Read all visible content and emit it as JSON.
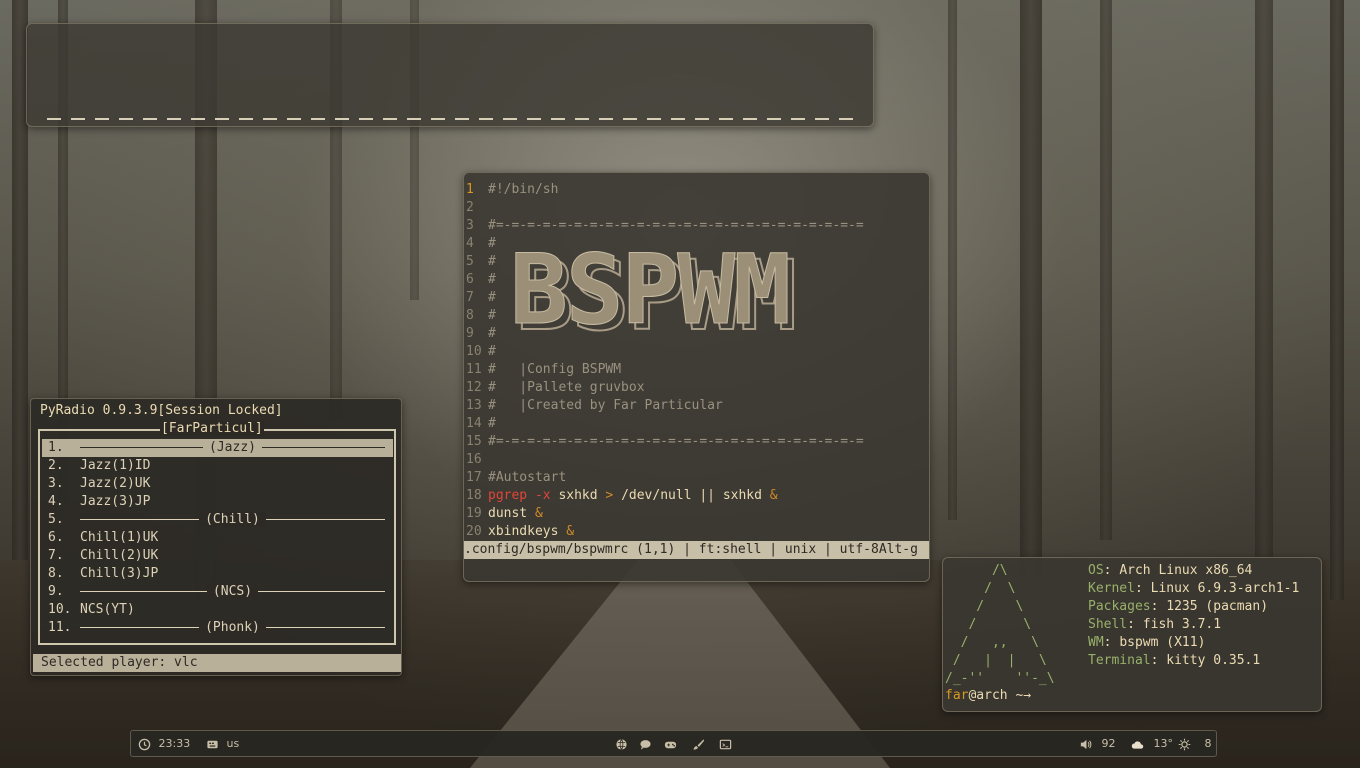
{
  "top_widget": {},
  "editor": {
    "lines": [
      {
        "n": "1",
        "segs": [
          {
            "t": "#!/bin/sh",
            "c": "cmt"
          }
        ],
        "current": true
      },
      {
        "n": "2",
        "segs": []
      },
      {
        "n": "3",
        "segs": [
          {
            "t": "#=-=-=-=-=-=-=-=-=-=-=-=-=-=-=-=-=-=-=-=-=-=-=-=",
            "c": "cmt"
          }
        ]
      },
      {
        "n": "4",
        "segs": [
          {
            "t": "#",
            "c": "cmt"
          }
        ]
      },
      {
        "n": "5",
        "segs": [
          {
            "t": "#",
            "c": "cmt"
          }
        ]
      },
      {
        "n": "6",
        "segs": [
          {
            "t": "#",
            "c": "cmt"
          }
        ]
      },
      {
        "n": "7",
        "segs": [
          {
            "t": "#",
            "c": "cmt"
          }
        ]
      },
      {
        "n": "8",
        "segs": [
          {
            "t": "#",
            "c": "cmt"
          }
        ]
      },
      {
        "n": "9",
        "segs": [
          {
            "t": "#",
            "c": "cmt"
          }
        ]
      },
      {
        "n": "10",
        "segs": [
          {
            "t": "#",
            "c": "cmt"
          }
        ]
      },
      {
        "n": "11",
        "segs": [
          {
            "t": "#   |Config BSPWM",
            "c": "cmt"
          }
        ]
      },
      {
        "n": "12",
        "segs": [
          {
            "t": "#   |Pallete gruvbox",
            "c": "cmt"
          }
        ]
      },
      {
        "n": "13",
        "segs": [
          {
            "t": "#   |Created by Far Particular",
            "c": "cmt"
          }
        ]
      },
      {
        "n": "14",
        "segs": [
          {
            "t": "#",
            "c": "cmt"
          }
        ]
      },
      {
        "n": "15",
        "segs": [
          {
            "t": "#=-=-=-=-=-=-=-=-=-=-=-=-=-=-=-=-=-=-=-=-=-=-=-=",
            "c": "cmt"
          }
        ]
      },
      {
        "n": "16",
        "segs": []
      },
      {
        "n": "17",
        "segs": [
          {
            "t": "#Autostart",
            "c": "cmt"
          }
        ]
      },
      {
        "n": "18",
        "segs": [
          {
            "t": "pgrep",
            "c": "kw"
          },
          {
            "t": " ",
            "c": "txt"
          },
          {
            "t": "-x",
            "c": "kw"
          },
          {
            "t": " sxhkd ",
            "c": "txt"
          },
          {
            "t": ">",
            "c": "op"
          },
          {
            "t": " /dev/null || sxhkd ",
            "c": "txt"
          },
          {
            "t": "&",
            "c": "op"
          }
        ]
      },
      {
        "n": "19",
        "segs": [
          {
            "t": "dunst ",
            "c": "txt"
          },
          {
            "t": "&",
            "c": "op"
          }
        ]
      },
      {
        "n": "20",
        "segs": [
          {
            "t": "xbindkeys ",
            "c": "txt"
          },
          {
            "t": "&",
            "c": "op"
          }
        ]
      }
    ],
    "banner_text": "BSPWM",
    "status_line": ".config/bspwm/bspwmrc (1,1) | ft:shell | unix | utf-8Alt-g"
  },
  "radio": {
    "title": "PyRadio 0.9.3.9[Session Locked]",
    "box_title": "[FarParticul]",
    "rows": [
      {
        "num": "1.",
        "name": "(Jazz)",
        "group": true,
        "selected": true
      },
      {
        "num": "2.",
        "name": "Jazz(1)ID"
      },
      {
        "num": "3.",
        "name": "Jazz(2)UK"
      },
      {
        "num": "4.",
        "name": "Jazz(3)JP"
      },
      {
        "num": "5.",
        "name": "(Chill)",
        "group": true
      },
      {
        "num": "6.",
        "name": "Chill(1)UK"
      },
      {
        "num": "7.",
        "name": "Chill(2)UK"
      },
      {
        "num": "8.",
        "name": "Chill(3)JP"
      },
      {
        "num": "9.",
        "name": "(NCS)",
        "group": true
      },
      {
        "num": "10.",
        "name": "NCS(YT)"
      },
      {
        "num": "11.",
        "name": "(Phonk)",
        "group": true
      }
    ],
    "status": "Selected player: vlc"
  },
  "fetch": {
    "art": "      /\\\n     /  \\\n    /    \\\n   /      \\\n  /   ,,   \\\n /   |  |   \\\n/_-''    ''-_\\",
    "info": [
      {
        "key": "OS",
        "val": "Arch Linux x86_64"
      },
      {
        "key": "Kernel",
        "val": "Linux 6.9.3-arch1-1"
      },
      {
        "key": "Packages",
        "val": "1235 (pacman)"
      },
      {
        "key": "Shell",
        "val": "fish 3.7.1"
      },
      {
        "key": "WM",
        "val": "bspwm (X11)"
      },
      {
        "key": "Terminal",
        "val": "kitty 0.35.1"
      }
    ],
    "user": "far",
    "host": "@arch",
    "prompt_symbol": " ~→"
  },
  "bar": {
    "time": "23:33",
    "keyboard_layout": "us",
    "volume": "92",
    "weather": "13°",
    "brightness": "8",
    "icons": [
      "clock-icon",
      "keyboard-icon",
      "globe-icon",
      "chat-icon",
      "gamepad-icon",
      "brush-icon",
      "terminal-icon",
      "volume-icon",
      "cloud-icon",
      "brightness-icon"
    ]
  }
}
